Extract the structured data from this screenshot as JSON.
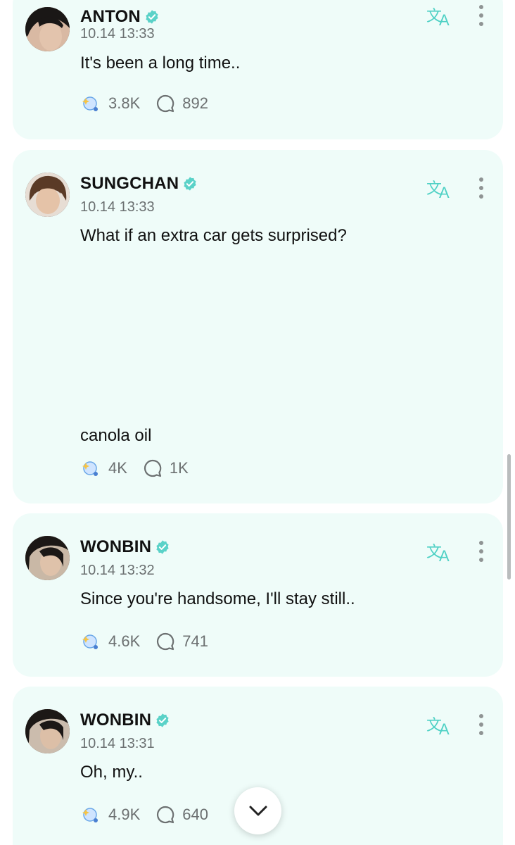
{
  "colors": {
    "card_bg": "#effcf9",
    "accent": "#4fd1c5",
    "muted_text": "#6a6f70",
    "verified_badge": "#5ad2c8"
  },
  "posts": [
    {
      "author": "ANTON",
      "time": "10.14 13:33",
      "text": "It's been a long time..",
      "likes": "3.8K",
      "comments": "892"
    },
    {
      "author": "SUNGCHAN",
      "time": "10.14 13:33",
      "text": "What if an extra car gets surprised?",
      "text_extra": "canola oil",
      "likes": "4K",
      "comments": "1K"
    },
    {
      "author": "WONBIN",
      "time": "10.14 13:32",
      "text": "Since you're handsome, I'll stay still..",
      "likes": "4.6K",
      "comments": "741"
    },
    {
      "author": "WONBIN",
      "time": "10.14 13:31",
      "text": "Oh, my..",
      "likes": "4.9K",
      "comments": "640"
    }
  ],
  "icons": {
    "translate": "translate-icon",
    "more": "more-vertical-icon",
    "like": "like-sparkle-icon",
    "comment": "comment-bubble-icon",
    "verified": "verified-badge-icon",
    "scroll_down": "chevron-down-icon"
  }
}
